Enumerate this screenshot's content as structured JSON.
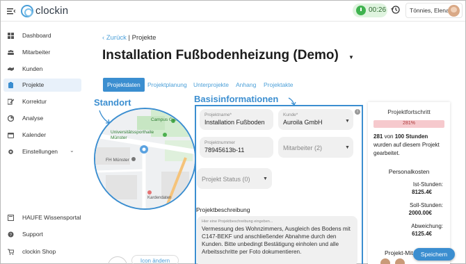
{
  "app": {
    "name": "clockin"
  },
  "header": {
    "timer": "00:26",
    "user": "Tönnies, Elena"
  },
  "sidebar": {
    "items": [
      {
        "label": "Dashboard",
        "icon": "dashboard-icon"
      },
      {
        "label": "Mitarbeiter",
        "icon": "users-icon"
      },
      {
        "label": "Kunden",
        "icon": "handshake-icon"
      },
      {
        "label": "Projekte",
        "icon": "clipboard-icon",
        "active": true
      },
      {
        "label": "Korrektur",
        "icon": "edit-icon"
      },
      {
        "label": "Analyse",
        "icon": "analytics-icon"
      },
      {
        "label": "Kalender",
        "icon": "calendar-icon"
      },
      {
        "label": "Einstellungen",
        "icon": "gear-icon"
      }
    ],
    "bottom_items": [
      {
        "label": "HAUFE Wissensportal",
        "icon": "book-icon"
      },
      {
        "label": "Support",
        "icon": "help-icon"
      },
      {
        "label": "clockin Shop",
        "icon": "cart-icon"
      }
    ]
  },
  "breadcrumb": {
    "back": "Zurück",
    "separator": "|",
    "current": "Projekte"
  },
  "page_title": "Installation Fußbodenheizung (Demo)",
  "tabs": [
    "Projektdaten",
    "Projektplanung",
    "Unterprojekte",
    "Anhang",
    "Projektakte"
  ],
  "sections": {
    "standort": "Standort",
    "basis": "Basisinformationen"
  },
  "map": {
    "labels": [
      "Campus Gym M",
      "Universitätssporthalle Münster",
      "FH Münster",
      "Kardendaten"
    ]
  },
  "icon_button": "Icon ändern",
  "form": {
    "projektname_label": "Projektname*",
    "projektname_value": "Installation Fußboden",
    "kunde_label": "Kunde*",
    "kunde_value": "Auroila GmbH",
    "projektnummer_label": "Projektnummer",
    "projektnummer_value": "78945613b-11",
    "mitarbeiter_placeholder": "Mitarbeiter (2)",
    "status_placeholder": "Projekt Status (0)",
    "beschreibung_title": "Projektbeschreibung",
    "beschreibung_placeholder": "Hier eine Projektbeschreibung eingeben...",
    "beschreibung_text": "Vermessung des Wohnzimmers, Ausgleich des Bodens mit C147-BEKF und anschließender Abnahme durch den Kunden. Bitte unbedingt Bestätigung einholen und alle Arbeitsschritte per Foto dokumentieren."
  },
  "progress": {
    "title": "Projektfortschritt",
    "percent_label": "281%",
    "percent": 2.81,
    "hours_done": "281",
    "hours_text_1": "von",
    "hours_total": "100 Stunden",
    "hours_text_2": "wurden auf diesem Projekt gearbeitet.",
    "cost_title": "Personalkosten",
    "ist_label": "Ist-Stunden:",
    "ist_value": "8125.4€",
    "soll_label": "Soll-Stunden:",
    "soll_value": "2000.00€",
    "abw_label": "Abweichung:",
    "abw_value": "6125.4€",
    "team_title": "Projekt-Mit"
  },
  "save_button": "Speichern",
  "colors": {
    "accent": "#3b8ed0",
    "progress_bg": "#f6c9cd",
    "timer_bg": "#dff4df"
  }
}
